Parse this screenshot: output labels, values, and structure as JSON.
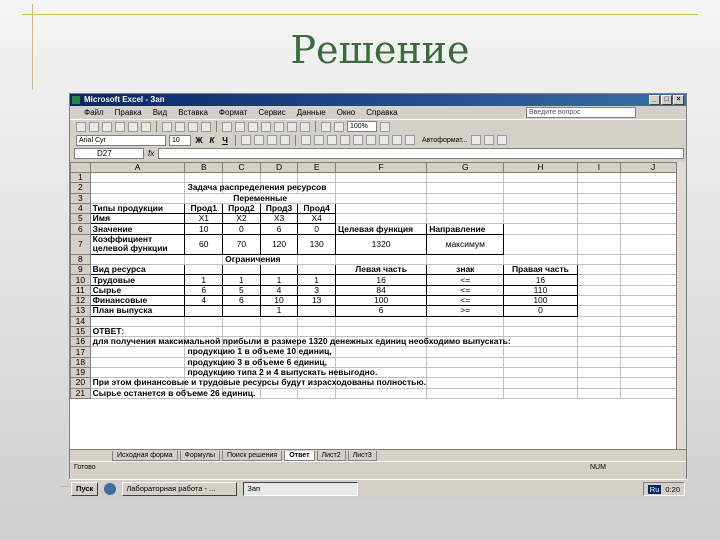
{
  "slide": {
    "title": "Решение"
  },
  "window": {
    "title": "Microsoft Excel - Зап"
  },
  "menu": {
    "items": [
      "Файл",
      "Правка",
      "Вид",
      "Вставка",
      "Формат",
      "Сервис",
      "Данные",
      "Окно",
      "Справка"
    ],
    "help_placeholder": "Введите вопрос"
  },
  "toolbar": {
    "zoom": "100%"
  },
  "format": {
    "font": "Arial Cyr",
    "size": "10",
    "autoformat": "Автоформат..."
  },
  "formula": {
    "cell_ref": "D27",
    "fx": "fx"
  },
  "columns": [
    "",
    "A",
    "B",
    "C",
    "D",
    "E",
    "F",
    "G",
    "H",
    "I",
    "J"
  ],
  "rows": {
    "r1": {
      "n": "1"
    },
    "r2": {
      "n": "2",
      "title": "Задача распределения ресурсов"
    },
    "r3": {
      "n": "3",
      "vars": "Переменные"
    },
    "r4": {
      "n": "4",
      "a": "Типы продукции",
      "b": "Прод1",
      "c": "Прод2",
      "d": "Прод3",
      "e": "Прод4"
    },
    "r5": {
      "n": "5",
      "a": "Имя",
      "b": "X1",
      "c": "X2",
      "d": "X3",
      "e": "X4"
    },
    "r6": {
      "n": "6",
      "a": "Значение",
      "b": "10",
      "c": "0",
      "d": "6",
      "e": "0",
      "f": "Целевая функция",
      "g": "Направление"
    },
    "r7": {
      "n": "7",
      "a": "Коэффициент целевой функции",
      "b": "60",
      "c": "70",
      "d": "120",
      "e": "130",
      "f": "1320",
      "g": "максимум"
    },
    "r8": {
      "n": "8",
      "c": "Ограничения"
    },
    "r9": {
      "n": "9",
      "a": "Вид ресурса",
      "f": "Левая часть",
      "g": "знак",
      "h": "Правая часть"
    },
    "r10": {
      "n": "10",
      "a": "Трудовые",
      "b": "1",
      "c": "1",
      "d": "1",
      "e": "1",
      "f": "16",
      "g": "<=",
      "h": "16"
    },
    "r11": {
      "n": "11",
      "a": "Сырье",
      "b": "6",
      "c": "5",
      "d": "4",
      "e": "3",
      "f": "84",
      "g": "<=",
      "h": "110"
    },
    "r12": {
      "n": "12",
      "a": "Финансовые",
      "b": "4",
      "c": "6",
      "d": "10",
      "e": "13",
      "f": "100",
      "g": "<=",
      "h": "100"
    },
    "r13": {
      "n": "13",
      "a": "План выпуска",
      "d": "1",
      "f": "6",
      "g": ">=",
      "h": "0"
    },
    "r14": {
      "n": "14"
    },
    "r15": {
      "n": "15",
      "a": "ОТВЕТ:"
    },
    "r16": {
      "n": "16",
      "a": "для получения максимальной прибыли в размере 1320 денежных единиц необходимо выпускать:"
    },
    "r17": {
      "n": "17",
      "b": "продукцию 1 в объеме 10 единиц,"
    },
    "r18": {
      "n": "18",
      "b": "продукцию 3 в объеме 6 единиц,"
    },
    "r19": {
      "n": "19",
      "b": "продукцию типа 2 и 4 выпускать невыгодно."
    },
    "r20": {
      "n": "20",
      "a": "При этом финансовые и трудовые ресурсы будут израсходованы полностью."
    },
    "r21": {
      "n": "21",
      "a": "Сырье останется в объеме 26 единиц."
    }
  },
  "sheets": [
    "Исходная форма",
    "Формулы",
    "Поиск решения",
    "Ответ",
    "Лист2",
    "Лист3"
  ],
  "status": {
    "left": "Готово",
    "right": "NUM"
  },
  "taskbar": {
    "start": "Пуск",
    "task1": "Лабораторная работа - ...",
    "task2": "Зап",
    "lang": "Ru",
    "time": "0:20"
  }
}
